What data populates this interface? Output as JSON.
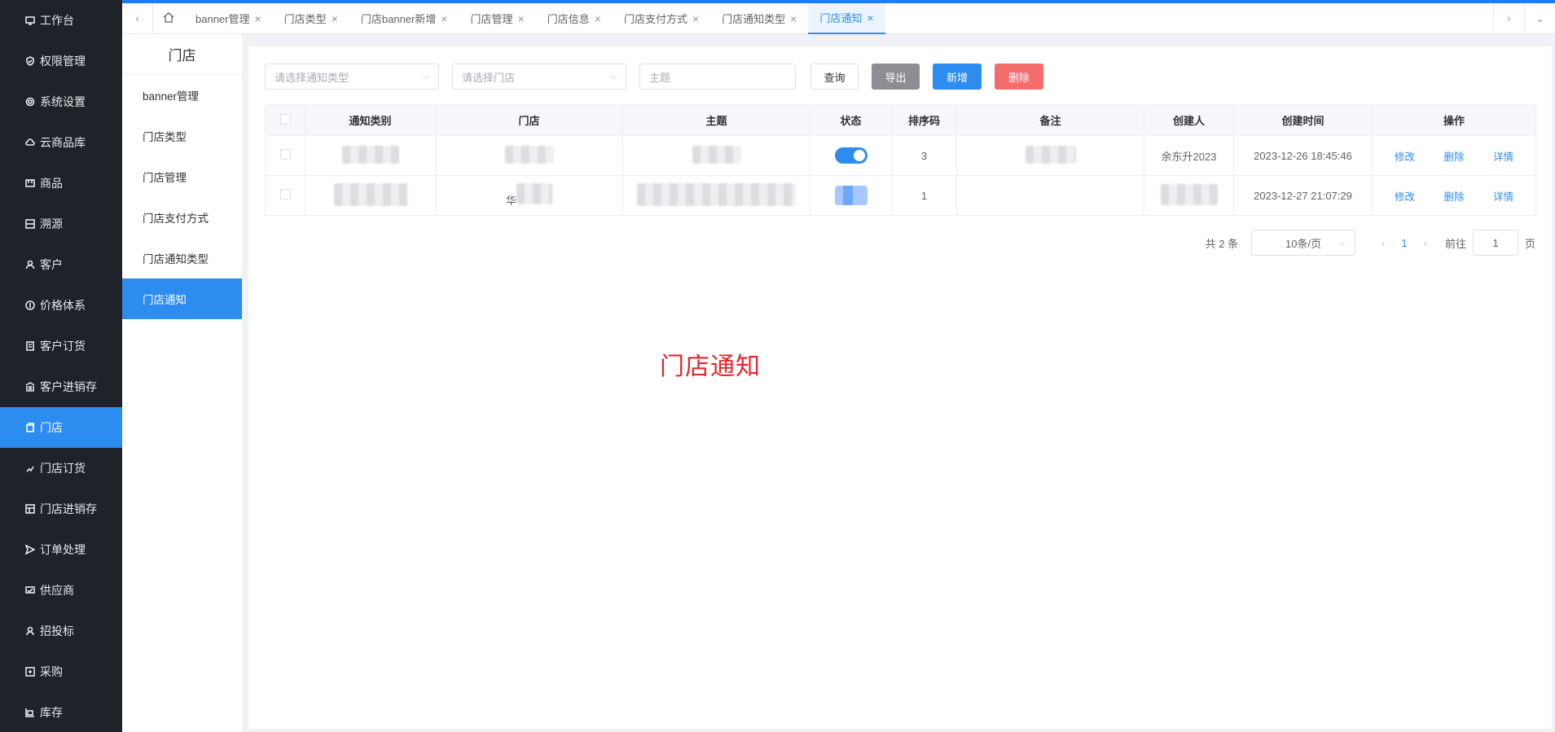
{
  "sidebar": {
    "items": [
      {
        "label": "工作台",
        "icon": "monitor-icon"
      },
      {
        "label": "权限管理",
        "icon": "shield-icon"
      },
      {
        "label": "系统设置",
        "icon": "gear-icon"
      },
      {
        "label": "云商品库",
        "icon": "cloud-icon"
      },
      {
        "label": "商品",
        "icon": "goods-icon"
      },
      {
        "label": "溯源",
        "icon": "trace-icon"
      },
      {
        "label": "客户",
        "icon": "user-icon"
      },
      {
        "label": "价格体系",
        "icon": "price-icon"
      },
      {
        "label": "客户订货",
        "icon": "order-icon"
      },
      {
        "label": "客户进销存",
        "icon": "bank-icon"
      },
      {
        "label": "门店",
        "icon": "store-icon"
      },
      {
        "label": "门店订货",
        "icon": "hand-icon"
      },
      {
        "label": "门店进销存",
        "icon": "stock-icon"
      },
      {
        "label": "订单处理",
        "icon": "send-icon"
      },
      {
        "label": "供应商",
        "icon": "supplier-icon"
      },
      {
        "label": "招投标",
        "icon": "bid-icon"
      },
      {
        "label": "采购",
        "icon": "purchase-icon"
      },
      {
        "label": "库存",
        "icon": "inventory-icon"
      }
    ],
    "active": "门店"
  },
  "tabs": [
    {
      "label": "banner管理"
    },
    {
      "label": "门店类型"
    },
    {
      "label": "门店banner新增"
    },
    {
      "label": "门店管理"
    },
    {
      "label": "门店信息"
    },
    {
      "label": "门店支付方式"
    },
    {
      "label": "门店通知类型"
    },
    {
      "label": "门店通知"
    }
  ],
  "subside": {
    "title": "门店",
    "items": [
      "banner管理",
      "门店类型",
      "门店管理",
      "门店支付方式",
      "门店通知类型",
      "门店通知"
    ]
  },
  "filters": {
    "type_placeholder": "请选择通知类型",
    "store_placeholder": "请选择门店",
    "subject_placeholder": "主题",
    "query": "查询",
    "export": "导出",
    "add": "新增",
    "delete": "删除"
  },
  "table": {
    "headers": [
      "通知类别",
      "门店",
      "主题",
      "状态",
      "排序码",
      "备注",
      "创建人",
      "创建时间",
      "操作"
    ],
    "rows": [
      {
        "sort": "3",
        "creator": "余东升2023",
        "created": "2023-12-26 18:45:46",
        "status_on": true
      },
      {
        "sort": "1",
        "store_prefix": "华",
        "creator": "",
        "created": "2023-12-27 21:07:29",
        "status_on": null
      }
    ],
    "actions": {
      "edit": "修改",
      "delete": "删除",
      "detail": "详情"
    }
  },
  "pager": {
    "total": "共 2 条",
    "size": "10条/页",
    "page": "1",
    "goto": "前往",
    "goto_value": "1",
    "page_suffix": "页"
  },
  "watermark": "门店通知",
  "colors": {
    "accent": "#2d8cf0",
    "danger": "#f56c6c",
    "sidebar_bg": "#1f2329"
  }
}
